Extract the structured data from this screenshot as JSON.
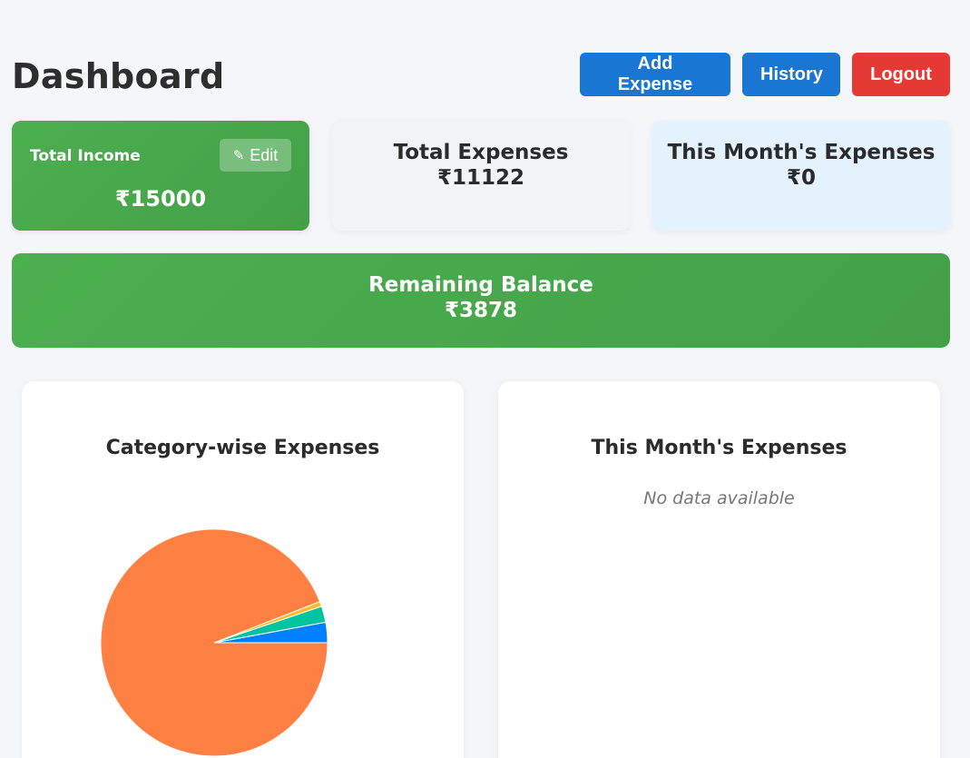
{
  "header": {
    "title": "Dashboard",
    "add_expense_label": "Add Expense",
    "history_label": "History",
    "logout_label": "Logout"
  },
  "cards": {
    "income": {
      "label": "Total Income",
      "edit_label": "Edit",
      "value": "₹15000"
    },
    "total_expenses": {
      "label": "Total Expenses",
      "value": "₹11122"
    },
    "month_expenses": {
      "label": "This Month's Expenses",
      "value": "₹0"
    }
  },
  "balance": {
    "label": "Remaining Balance",
    "value": "₹3878"
  },
  "panels": {
    "category": {
      "title": "Category-wise Expenses"
    },
    "month": {
      "title": "This Month's Expenses",
      "empty_text": "No data available"
    }
  },
  "icons": {
    "edit": "pencil-icon"
  },
  "colors": {
    "primary": "#1976d2",
    "danger": "#e53935",
    "success": "#4caf50",
    "month_card_bg": "#e3f2fd"
  },
  "chart_data": {
    "type": "pie",
    "title": "Category-wise Expenses",
    "slices": [
      {
        "value": 2.9,
        "color": "#0080ff"
      },
      {
        "value": 2.3,
        "color": "#00c49f"
      },
      {
        "value": 0.7,
        "color": "#ffbb28"
      },
      {
        "value": 94.1,
        "color": "#ff8042"
      }
    ]
  }
}
